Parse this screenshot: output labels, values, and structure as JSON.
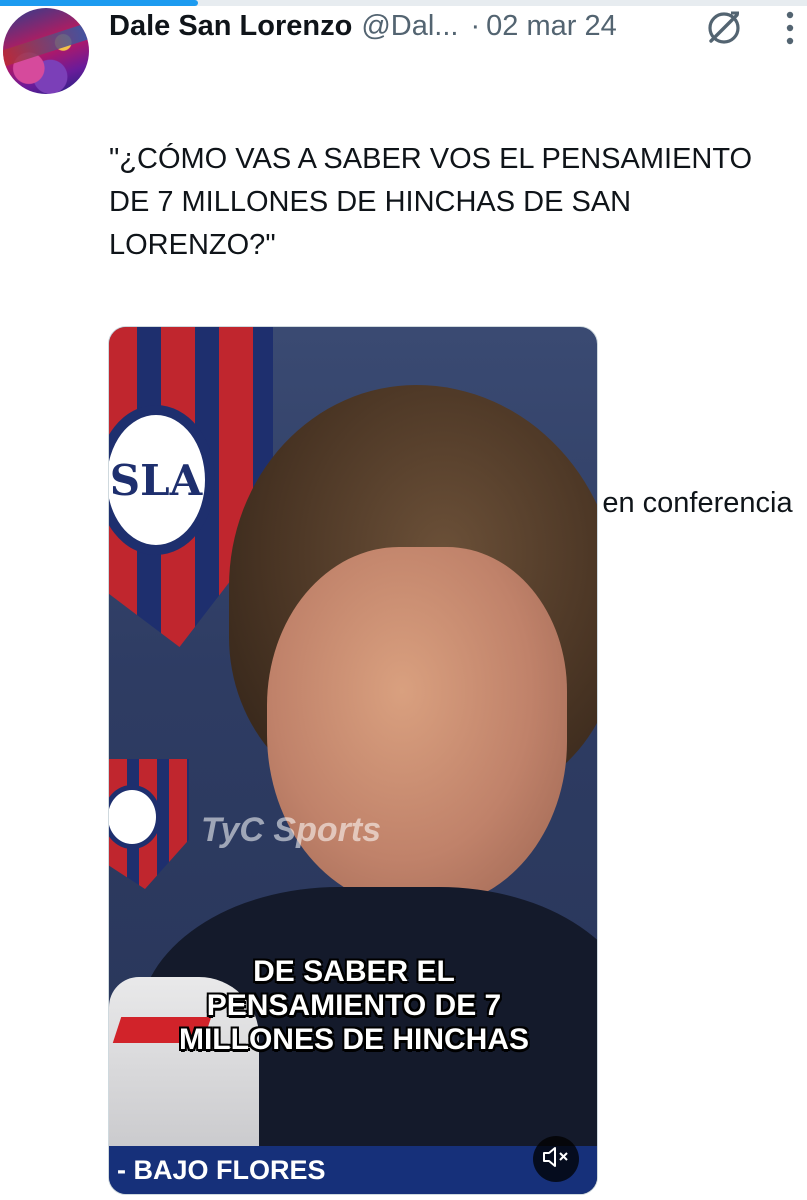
{
  "progress": {
    "fraction": 0.245,
    "color": "#1d9bf0"
  },
  "tweet": {
    "display_name": "Dale San Lorenzo",
    "handle": "@Dal...",
    "separator": "·",
    "date": "02 mar 24",
    "text_line1": "\"¿CÓMO VAS A SABER VOS EL PENSAMIENTO DE 7 MILLONES DE HINCHAS DE SAN LORENZO?\"",
    "text_line2": "La respuesta de Insua a un periodista en conferencia"
  },
  "media": {
    "subtitle": "DE SABER EL PENSAMIENTO DE 7 MILLONES DE HINCHAS",
    "lower_third": "- BAJO FLORES",
    "crest_text": "SLA",
    "broadcaster_watermark": "TyC Sports"
  },
  "icons": {
    "grok": "grok-icon",
    "more": "more-icon",
    "mute": "speaker-muted-icon"
  }
}
